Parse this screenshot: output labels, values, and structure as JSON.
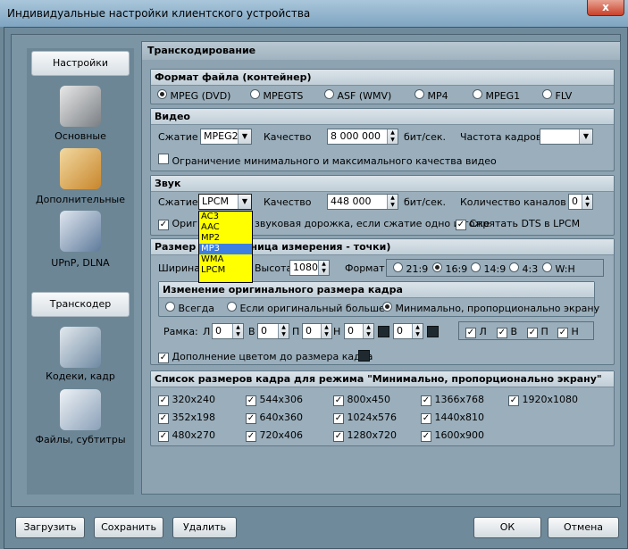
{
  "window": {
    "title": "Индивидуальные настройки клиентского устройства",
    "close": "x"
  },
  "sidebar": {
    "settings_header": "Настройки",
    "items": [
      {
        "label": "Основные"
      },
      {
        "label": "Дополнительные"
      },
      {
        "label": "UPnP, DLNA"
      }
    ],
    "transcoder_header": "Транскодер",
    "items2": [
      {
        "label": "Кодеки, кадр"
      },
      {
        "label": "Файлы, субтитры"
      }
    ]
  },
  "panel": {
    "title": "Транскодирование"
  },
  "format": {
    "title": "Формат файла (контейнер)",
    "options": [
      "MPEG (DVD)",
      "MPEGTS",
      "ASF (WMV)",
      "MP4",
      "MPEG1",
      "FLV"
    ],
    "selected": "MPEG (DVD)"
  },
  "video": {
    "title": "Видео",
    "compress_label": "Сжатие",
    "compress_value": "MPEG2",
    "quality_label": "Качество",
    "quality_value": "8 000 000",
    "unit": "бит/сек.",
    "framerate_label": "Частота кадров",
    "framerate_value": "",
    "limit_label": "Ограничение минимального и максимального качества видео"
  },
  "audio": {
    "title": "Звук",
    "compress_label": "Сжатие",
    "compress_value": "LPCM",
    "quality_label": "Качество",
    "quality_value": "448 000",
    "unit": "бит/сек.",
    "channels_label": "Количество каналов",
    "channels_value": "0",
    "orig_label_a": "Ориги",
    "orig_label_b": "звуковая дорожка, если сжатие одно и тоже",
    "hide_dts_label": "Спрятать DTS в LPCM",
    "dropdown": [
      "AC3",
      "AAC",
      "MP2",
      "MP3",
      "WMA",
      "LPCM"
    ],
    "highlighted": "MP3"
  },
  "size": {
    "title_a": "Размер к",
    "title_b": "ница измерения - точки)",
    "width_label": "Ширина",
    "height_label": "Высота",
    "height_value": "1080",
    "format_label": "Формат",
    "aspects": [
      "21:9",
      "16:9",
      "14:9",
      "4:3",
      "W:H"
    ],
    "selected_aspect": "16:9"
  },
  "resize": {
    "title": "Изменение оригинального размера кадра",
    "options": [
      "Всегда",
      "Если оригинальный больше",
      "Минимально, пропорционально экрану"
    ],
    "selected": "Минимально, пропорционально экрану",
    "frame_label": "Рамка:",
    "sides": [
      {
        "l": "Л",
        "v": "0"
      },
      {
        "l": "В",
        "v": "0"
      },
      {
        "l": "П",
        "v": "0"
      },
      {
        "l": "Н",
        "v": "0"
      },
      {
        "l": "",
        "v": "0"
      }
    ],
    "checks": [
      "Л",
      "В",
      "П",
      "Н"
    ],
    "fill_label": "Дополнение цветом до размера кадра"
  },
  "list": {
    "title": "Список размеров кадра для режима \"Минимально, пропорционально экрану\"",
    "col1": [
      "320x240",
      "352x198",
      "480x270"
    ],
    "col2": [
      "544x306",
      "640x360",
      "720x406"
    ],
    "col3": [
      "800x450",
      "1024x576",
      "1280x720"
    ],
    "col4": [
      "1366x768",
      "1440x810",
      "1600x900"
    ],
    "col5": [
      "1920x1080"
    ]
  },
  "buttons": {
    "load": "Загрузить",
    "save": "Сохранить",
    "delete": "Удалить",
    "ok": "ОК",
    "cancel": "Отмена"
  }
}
